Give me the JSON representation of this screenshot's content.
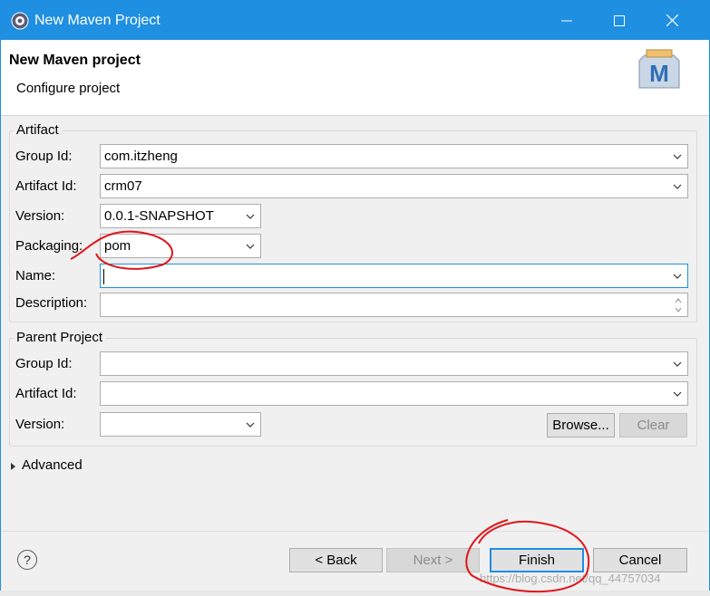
{
  "window": {
    "title": "New Maven Project",
    "icon": "eclipse-gear-icon"
  },
  "header": {
    "title": "New Maven project",
    "subtitle": "Configure project",
    "logo_letter": "M"
  },
  "artifact": {
    "legend": "Artifact",
    "group_id_label": "Group Id:",
    "group_id_value": "com.itzheng",
    "artifact_id_label": "Artifact Id:",
    "artifact_id_value": "crm07",
    "version_label": "Version:",
    "version_value": "0.0.1-SNAPSHOT",
    "packaging_label": "Packaging:",
    "packaging_value": "pom",
    "name_label": "Name:",
    "name_value": "",
    "description_label": "Description:",
    "description_value": ""
  },
  "parent": {
    "legend": "Parent Project",
    "group_id_label": "Group Id:",
    "group_id_value": "",
    "artifact_id_label": "Artifact Id:",
    "artifact_id_value": "",
    "version_label": "Version:",
    "version_value": "",
    "browse_label": "Browse...",
    "clear_label": "Clear"
  },
  "advanced": {
    "label": "Advanced",
    "expanded": false
  },
  "buttons": {
    "help": "?",
    "back": "< Back",
    "next": "Next >",
    "finish": "Finish",
    "cancel": "Cancel"
  },
  "watermark": "https://blog.csdn.net/qq_44757034",
  "colors": {
    "accent": "#1e8fe1",
    "annotation": "#e0161b"
  }
}
